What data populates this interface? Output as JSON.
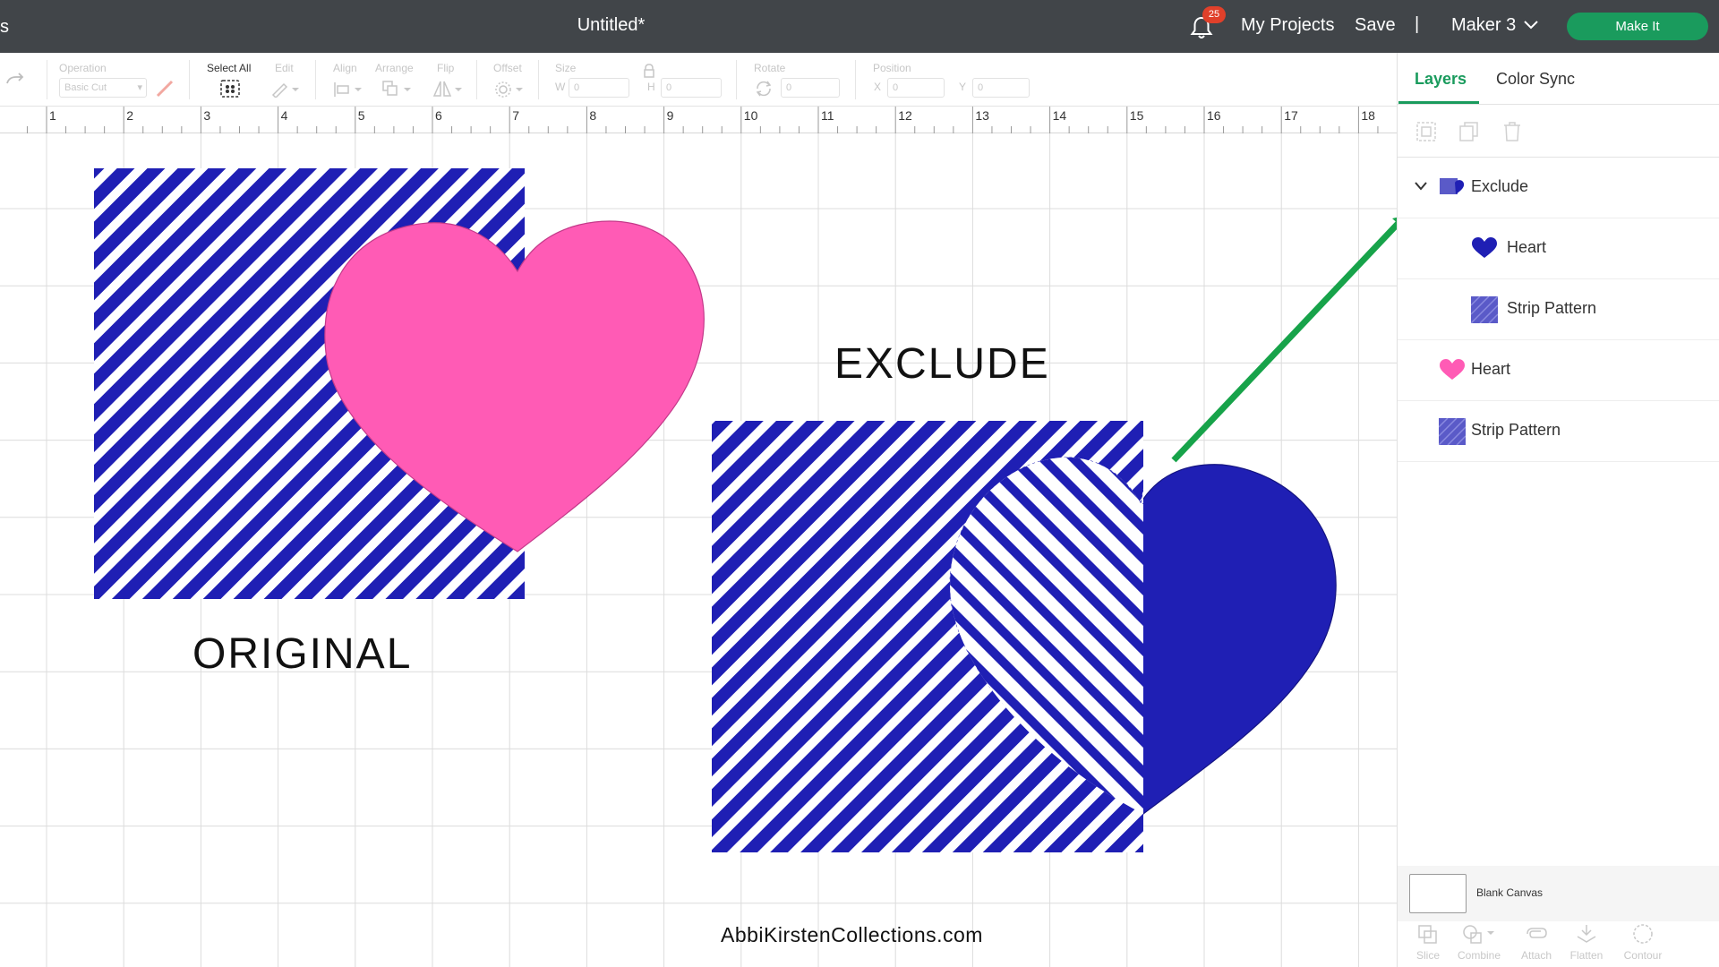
{
  "header": {
    "edge_glyph": "s",
    "title": "Untitled*",
    "notifications_count": "25",
    "my_projects": "My Projects",
    "save": "Save",
    "separator": "|",
    "machine": "Maker 3",
    "make_it": "Make It"
  },
  "toolbar": {
    "operation_label": "Operation",
    "operation_value": "Basic Cut",
    "select_all_label": "Select All",
    "edit_label": "Edit",
    "align_label": "Align",
    "arrange_label": "Arrange",
    "flip_label": "Flip",
    "offset_label": "Offset",
    "size_label": "Size",
    "w_label": "W",
    "h_label": "H",
    "w_value": "0",
    "h_value": "0",
    "rotate_label": "Rotate",
    "rotate_value": "0",
    "position_label": "Position",
    "x_label": "X",
    "y_label": "Y",
    "x_value": "0",
    "y_value": "0"
  },
  "ruler": {
    "numbers": [
      "1",
      "2",
      "3",
      "4",
      "5",
      "6",
      "7",
      "8",
      "9",
      "10",
      "11",
      "12",
      "13",
      "14",
      "15",
      "16",
      "17",
      "18"
    ]
  },
  "canvas": {
    "original_label": "ORIGINAL",
    "exclude_label": "EXCLUDE",
    "website": "AbbiKirstenCollections.com",
    "colors": {
      "stripe_blue": "#1f1fb4",
      "heart_pink": "#ff5bb5",
      "arrow_green": "#17a34a",
      "grid": "#dcdcdc"
    }
  },
  "panel": {
    "tabs": [
      "Layers",
      "Color Sync"
    ],
    "active_tab": "Layers",
    "layers": [
      {
        "name": "Exclude",
        "icon": "exclude-group-icon",
        "expanded": true
      },
      {
        "name": "Heart",
        "icon": "blue-heart-icon"
      },
      {
        "name": "Strip Pattern",
        "icon": "stripe-pattern-icon"
      },
      {
        "name": "Heart",
        "icon": "pink-heart-icon"
      },
      {
        "name": "Strip Pattern",
        "icon": "stripe-pattern-icon"
      }
    ],
    "blank_canvas": "Blank Canvas",
    "bottom_tools": [
      "Slice",
      "Combine",
      "Attach",
      "Flatten",
      "Contour"
    ]
  },
  "accent_color": "#1a9b5d"
}
